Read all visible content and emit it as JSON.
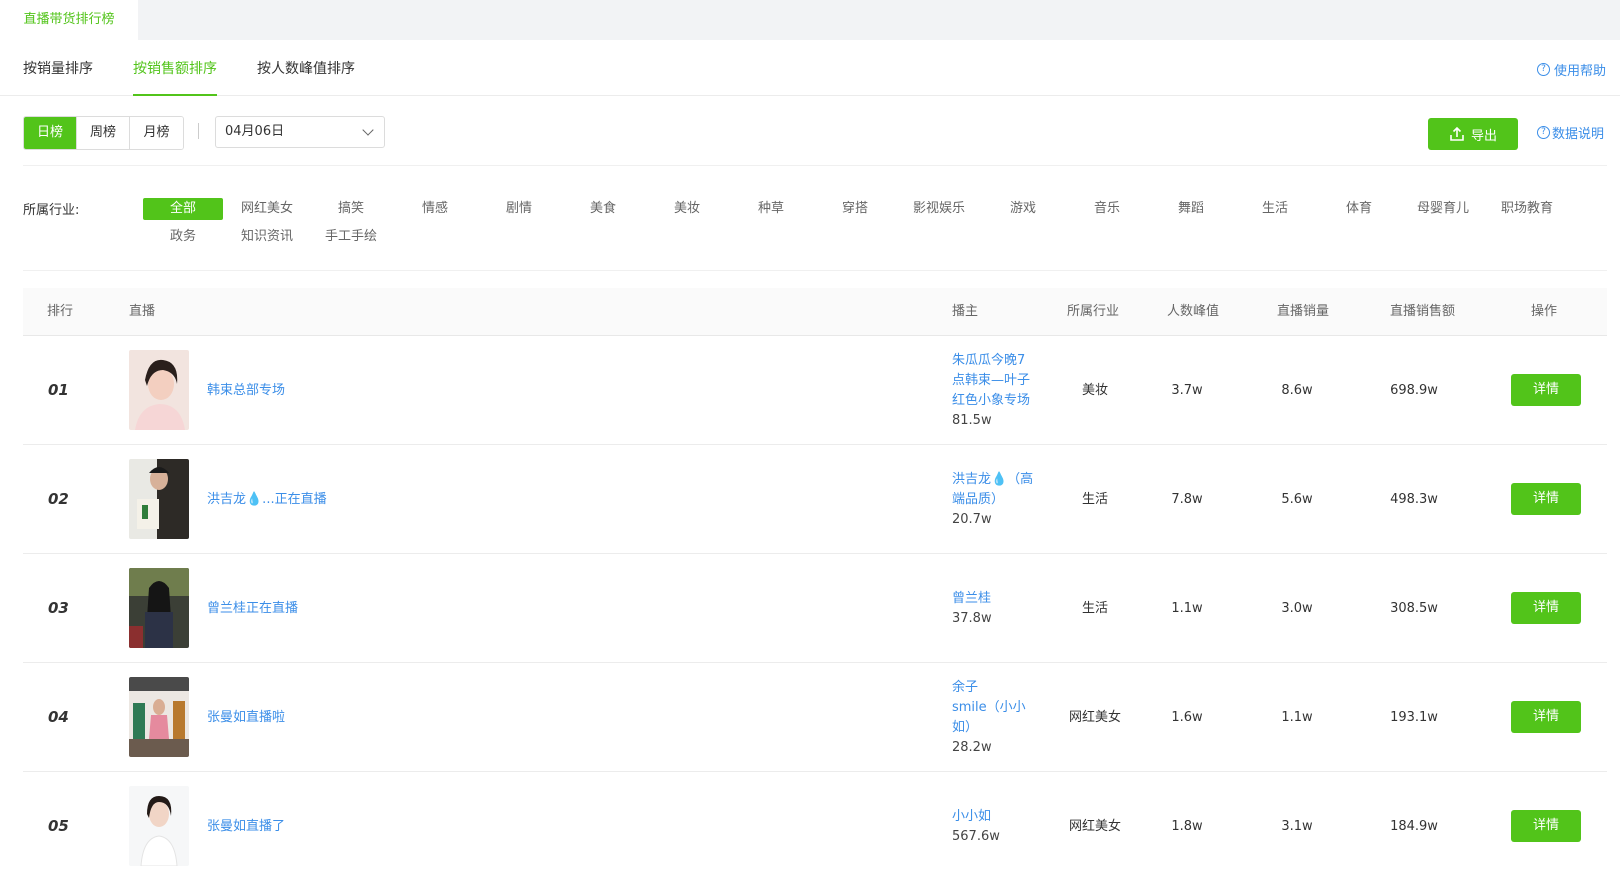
{
  "top_tab": "直播带货排行榜",
  "sort_tabs": [
    "按销量排序",
    "按销售额排序",
    "按人数峰值排序"
  ],
  "help_link": "使用帮助",
  "periods": [
    "日榜",
    "周榜",
    "月榜"
  ],
  "date_value": "04月06日",
  "export_label": "导出",
  "data_note_label": "数据说明",
  "industry_label": "所属行业:",
  "industries": [
    "全部",
    "网红美女",
    "搞笑",
    "情感",
    "剧情",
    "美食",
    "美妆",
    "种草",
    "穿搭",
    "影视娱乐",
    "游戏",
    "音乐",
    "舞蹈",
    "生活",
    "体育",
    "母婴育儿",
    "职场教育",
    "政务",
    "知识资讯",
    "手工手绘"
  ],
  "columns": [
    "排行",
    "直播",
    "播主",
    "所属行业",
    "人数峰值",
    "直播销量",
    "直播销售额",
    "操作"
  ],
  "detail_label": "详情",
  "rows": [
    {
      "rank": "01",
      "title": "韩束总部专场",
      "host_lines": [
        "朱瓜瓜今晚7",
        "点韩束—叶子",
        "红色小象专场"
      ],
      "fans": "81.5w",
      "industry": "美妆",
      "peak": "3.7w",
      "sales": "8.6w",
      "revenue": "698.9w"
    },
    {
      "rank": "02",
      "title": "洪吉龙💧...正在直播",
      "host_lines": [
        "洪吉龙💧（高",
        "端品质）"
      ],
      "fans": "20.7w",
      "industry": "生活",
      "peak": "7.8w",
      "sales": "5.6w",
      "revenue": "498.3w"
    },
    {
      "rank": "03",
      "title": "曾兰桂正在直播",
      "host_lines": [
        "曾兰桂"
      ],
      "fans": "37.8w",
      "industry": "生活",
      "peak": "1.1w",
      "sales": "3.0w",
      "revenue": "308.5w"
    },
    {
      "rank": "04",
      "title": "张曼如直播啦",
      "host_lines": [
        "余子",
        "smile（小小",
        "如）"
      ],
      "fans": "28.2w",
      "industry": "网红美女",
      "peak": "1.6w",
      "sales": "1.1w",
      "revenue": "193.1w"
    },
    {
      "rank": "05",
      "title": "张曼如直播了",
      "host_lines": [
        "小小如"
      ],
      "fans": "567.6w",
      "industry": "网红美女",
      "peak": "1.8w",
      "sales": "3.1w",
      "revenue": "184.9w"
    }
  ],
  "colors": {
    "accent": "#52c41a",
    "link": "#3b8ee8"
  }
}
